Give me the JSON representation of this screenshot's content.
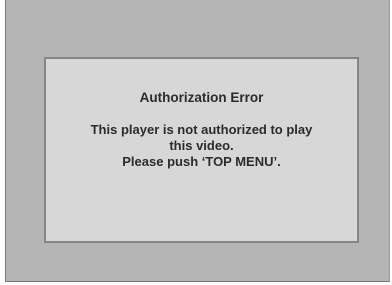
{
  "dialog": {
    "title": "Authorization Error",
    "message_lines": [
      "This player is not authorized to play",
      "this video.",
      "Please push ‘TOP MENU’."
    ]
  }
}
